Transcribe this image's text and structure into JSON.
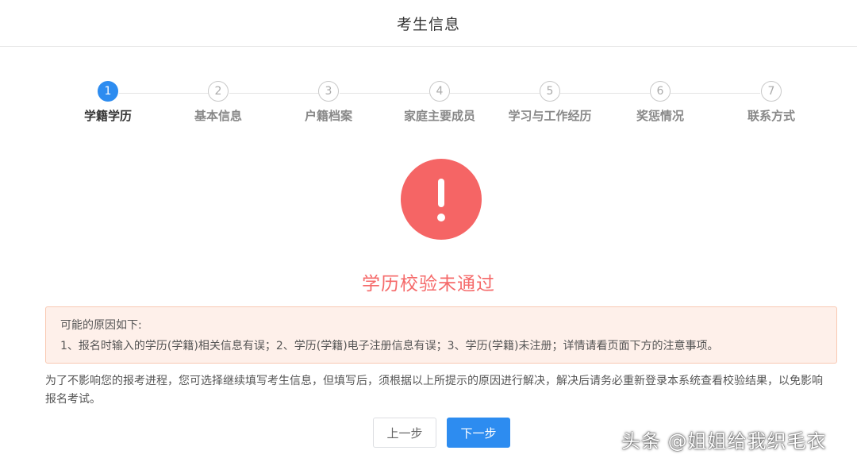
{
  "header": {
    "title": "考生信息"
  },
  "steps": [
    {
      "num": "1",
      "label": "学籍学历"
    },
    {
      "num": "2",
      "label": "基本信息"
    },
    {
      "num": "3",
      "label": "户籍档案"
    },
    {
      "num": "4",
      "label": "家庭主要成员"
    },
    {
      "num": "5",
      "label": "学习与工作经历"
    },
    {
      "num": "6",
      "label": "奖惩情况"
    },
    {
      "num": "7",
      "label": "联系方式"
    }
  ],
  "active_step": 1,
  "result": {
    "icon": "exclamation-icon",
    "title": "学历校验未通过",
    "icon_color": "#f56565",
    "title_color": "#f56a6a"
  },
  "reasons": {
    "heading": "可能的原因如下:",
    "text": "1、报名时输入的学历(学籍)相关信息有误；2、学历(学籍)电子注册信息有误；3、学历(学籍)未注册；详情请看页面下方的注意事项。"
  },
  "notice": "为了不影响您的报考进程，您可选择继续填写考生信息，但填写后，须根据以上所提示的原因进行解决，解决后请务必重新登录本系统查看校验结果，以免影响报名考试。",
  "buttons": {
    "prev": "上一步",
    "next": "下一步"
  },
  "watermark": "头条 @姐姐给我织毛衣",
  "colors": {
    "accent": "#2d8cf0",
    "error": "#f56565"
  }
}
